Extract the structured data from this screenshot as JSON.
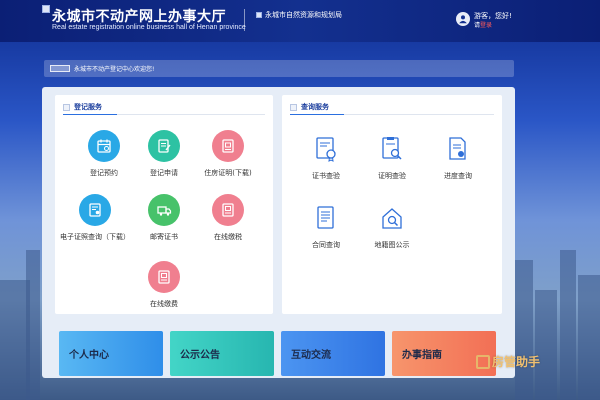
{
  "header": {
    "title": "永城市不动产网上办事大厅",
    "subtitle": "Real estate registration online business hall of Henan province",
    "bureau": "永城市自然资源和规划局",
    "user_greeting": "游客，您好!",
    "login_prefix": "请",
    "login_link": "登录"
  },
  "welcome": {
    "text": "永城市不动产登记中心欢迎您!"
  },
  "registration": {
    "title": "登记服务",
    "items": [
      {
        "label": "登记预约",
        "icon": "calendar-icon",
        "color": "#29a8e6"
      },
      {
        "label": "登记申请",
        "icon": "form-edit-icon",
        "color": "#2dc2a3"
      },
      {
        "label": "住房证明(下载)",
        "icon": "certificate-download-icon",
        "color": "#f07f8f"
      },
      {
        "label": "电子证照查询（下载）",
        "icon": "e-license-icon",
        "color": "#29a8e6"
      },
      {
        "label": "邮寄证书",
        "icon": "delivery-truck-icon",
        "color": "#47c26a"
      },
      {
        "label": "在线缴税",
        "icon": "tax-payment-icon",
        "color": "#f07f8f"
      },
      {
        "label": "在线缴费",
        "icon": "fee-payment-icon",
        "color": "#f07f8f"
      }
    ]
  },
  "query": {
    "title": "查询服务",
    "items": [
      {
        "label": "证书查验",
        "icon": "certificate-verify-icon"
      },
      {
        "label": "证明查验",
        "icon": "proof-search-icon"
      },
      {
        "label": "进度查询",
        "icon": "progress-doc-icon"
      },
      {
        "label": "合同查询",
        "icon": "contract-icon"
      },
      {
        "label": "地籍图公示",
        "icon": "cadastral-map-icon"
      }
    ]
  },
  "cards": [
    {
      "label": "个人中心"
    },
    {
      "label": "公示公告"
    },
    {
      "label": "互动交流"
    },
    {
      "label": "办事指南"
    }
  ],
  "watermark": {
    "text": "房管助手"
  },
  "colors": {
    "header": "#13308f",
    "accent": "#2a6fe0",
    "outline_icon": "#2f6fd8"
  }
}
